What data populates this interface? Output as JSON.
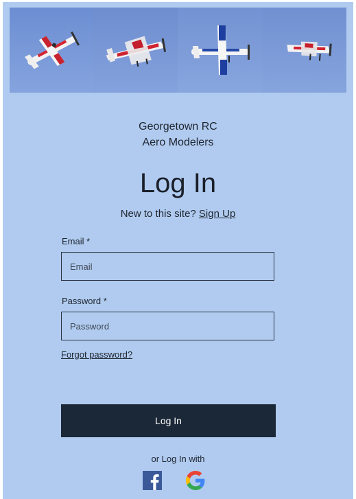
{
  "site": {
    "name_line1": "Georgetown RC",
    "name_line2": "Aero Modelers"
  },
  "login": {
    "title": "Log In",
    "new_prompt": "New to this site?",
    "signup_link": "Sign Up",
    "email_label": "Email *",
    "email_placeholder": "Email",
    "email_value": "",
    "password_label": "Password *",
    "password_placeholder": "Password",
    "password_value": "",
    "forgot_link": "Forgot password?",
    "submit_label": "Log In",
    "social_prompt": "or Log In with"
  },
  "social": [
    {
      "provider": "facebook",
      "icon": "facebook-icon",
      "color": "#3b5998"
    },
    {
      "provider": "google",
      "icon": "google-icon"
    }
  ],
  "colors": {
    "background": "#b0cbef",
    "button": "#1b2837",
    "text": "#1f2530"
  }
}
